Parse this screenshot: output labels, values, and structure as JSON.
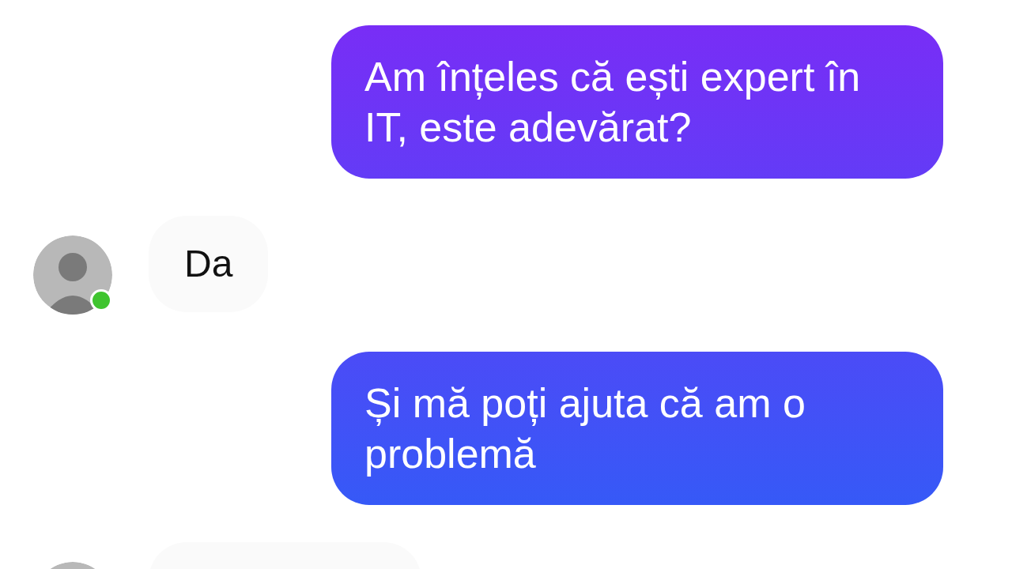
{
  "messages": [
    {
      "kind": "sent",
      "text": "Am înțeles că ești expert în IT, este adevărat?"
    },
    {
      "kind": "received",
      "text": "Da",
      "avatar_online": true
    },
    {
      "kind": "sent",
      "text": "Și mă poți ajuta că am o problemă"
    },
    {
      "kind": "received"
    }
  ]
}
